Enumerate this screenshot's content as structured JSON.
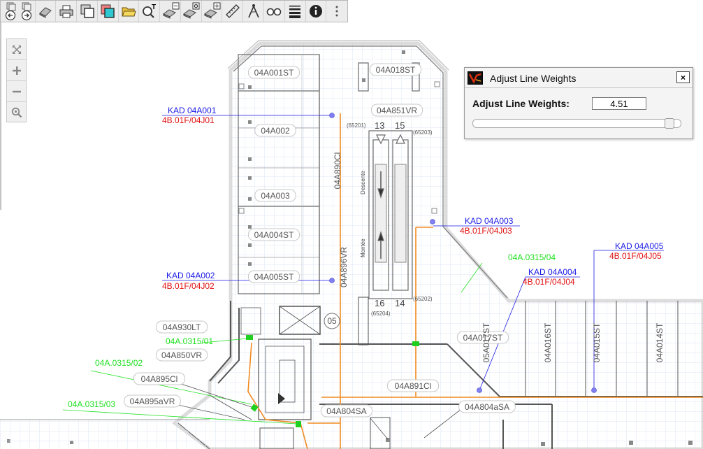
{
  "toolbar": {
    "buttons": [
      "back-icon",
      "forward-icon",
      "eraser-icon",
      "print-icon",
      "copy-window-icon",
      "copy-color-icon",
      "open-folder-icon",
      "search-text-icon",
      "layer-minus-icon",
      "layer-settings-icon",
      "layer-plus-icon",
      "ruler-icon",
      "compass-icon",
      "binoculars-icon",
      "line-weights-icon",
      "info-icon",
      "more-menu-icon"
    ],
    "layer_badges": {
      "minus": "−",
      "settings": "⚙",
      "plus": "+"
    },
    "search_badge": "T"
  },
  "zoom": {
    "buttons": [
      "fullscreen-icon",
      "zoom-in-icon",
      "zoom-out-icon",
      "zoom-fit-icon"
    ]
  },
  "dialog": {
    "title": "Adjust Line Weights",
    "close_glyph": "×",
    "label": "Adjust Line Weights:",
    "value": "4.51",
    "slider_level": 0.965
  },
  "rooms": [
    "04A001ST",
    "04A018ST",
    "04A851VR",
    "04A002",
    "04A003",
    "04A004ST",
    "04A005ST",
    "04A930LT",
    "04A850VR",
    "04A895Cl",
    "04A895aVR",
    "04A804SA",
    "04A804aSA",
    "04A891Cl",
    "04A017ST"
  ],
  "vertical_rooms": [
    "04A890Cl",
    "04A896VR",
    "05A017ST",
    "04A016ST",
    "04A015ST",
    "04A014ST"
  ],
  "stairs": {
    "top_left": "13",
    "top_right": "15",
    "bottom_left": "16",
    "bottom_right": "14",
    "descend": "Descente",
    "ascend": "Montée"
  },
  "codes": [
    "(65201)",
    "(65203)",
    "(65202)",
    "(65204)"
  ],
  "circle_label": "05",
  "devices": [
    {
      "kad": "KAD 04A001",
      "ref": "4B.01F/04J01"
    },
    {
      "kad": "KAD 04A002",
      "ref": "4B.01F/04J02"
    },
    {
      "kad": "KAD 04A003",
      "ref": "4B.01F/04J03"
    },
    {
      "kad": "KAD 04A004",
      "ref": "4B.01F/04J04"
    },
    {
      "kad": "KAD 04A005",
      "ref": "4B.01F/04J05"
    }
  ],
  "green_labels": [
    "04A.0315/04",
    "04A.0315/01",
    "04A.0315/02",
    "04A.0315/03"
  ],
  "colors": {
    "blue_label": "#1a1ae6",
    "red_label": "#e01010",
    "green_label": "#20e020",
    "orange_line": "#f08a20",
    "wall": "#6a6a6a"
  }
}
